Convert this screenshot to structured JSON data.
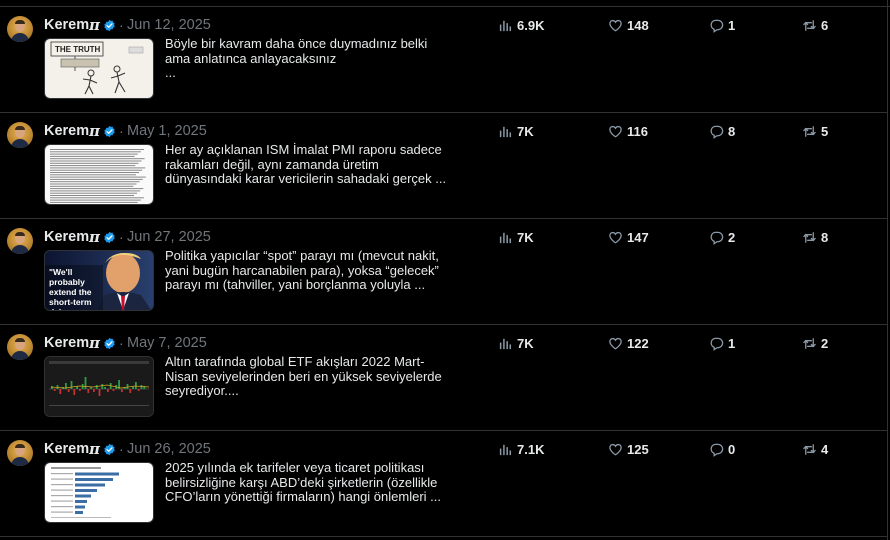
{
  "colors": {
    "background": "#000000",
    "text": "#e7e9ea",
    "muted": "#71767b",
    "border": "#2f3336",
    "verified": "#1d9bf0"
  },
  "icons": {
    "views": "bar-chart-icon",
    "likes": "heart-icon",
    "replies": "speech-bubble-icon",
    "reposts": "repost-arrows-icon",
    "verified": "verified-badge-icon"
  },
  "posts": [
    {
      "author": "Kerem",
      "author_symbol": "π",
      "separator": "·",
      "date": "Jun 12, 2025",
      "text": "Böyle bir kavram daha önce duymadınız belki ama anlatınca anlayacaksınız\n...",
      "thumbnail_caption": "THE TRUTH",
      "stats": {
        "views": "6.9K",
        "likes": "148",
        "replies": "1",
        "reposts": "6"
      }
    },
    {
      "author": "Kerem",
      "author_symbol": "π",
      "separator": "·",
      "date": "May 1, 2025",
      "text": "Her ay açıklanan ISM İmalat PMI raporu sadece rakamları değil, aynı zamanda üretim dünyasındaki karar vericilerin sahadaki gerçek ...",
      "stats": {
        "views": "7K",
        "likes": "116",
        "replies": "8",
        "reposts": "5"
      }
    },
    {
      "author": "Kerem",
      "author_symbol": "π",
      "separator": "·",
      "date": "Jun 27, 2025",
      "text": "Politika yapıcılar “spot” parayı mı (mevcut nakit, yani bugün harcanabilen para), yoksa “gelecek” parayı mı (tahviller, yani borçlanma yoluyla ...",
      "thumbnail_caption": "\"We'll probably extend the short-term deb",
      "stats": {
        "views": "7K",
        "likes": "147",
        "replies": "2",
        "reposts": "8"
      }
    },
    {
      "author": "Kerem",
      "author_symbol": "π",
      "separator": "·",
      "date": "May 7, 2025",
      "text": "Altın tarafında global ETF akışları 2022 Mart-Nisan seviyelerinden beri en yüksek seviyelerde seyrediyor....",
      "stats": {
        "views": "7K",
        "likes": "122",
        "replies": "1",
        "reposts": "2"
      }
    },
    {
      "author": "Kerem",
      "author_symbol": "π",
      "separator": "·",
      "date": "Jun 26, 2025",
      "text": "2025 yılında ek tarifeler veya ticaret politikası belirsizliğine karşı ABD’deki şirketlerin (özellikle CFO’ların yönettiği firmaların) hangi önlemleri ...",
      "stats": {
        "views": "7.1K",
        "likes": "125",
        "replies": "0",
        "reposts": "4"
      }
    }
  ]
}
